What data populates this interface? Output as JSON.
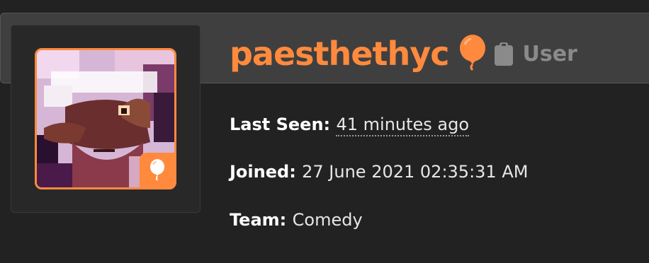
{
  "profile": {
    "username": "paesthethyc",
    "role": "User",
    "rank_icon": "balloon-icon",
    "role_icon": "clipboard-icon"
  },
  "details": {
    "last_seen_label": "Last Seen:",
    "last_seen_value": "41 minutes ago",
    "joined_label": "Joined:",
    "joined_value": "27 June 2021 02:35:31 AM",
    "team_label": "Team:",
    "team_value": "Comedy"
  },
  "colors": {
    "accent": "#ff8a3d",
    "background": "#222222",
    "banner": "#3f3f3f",
    "muted": "#8a8a8a"
  }
}
